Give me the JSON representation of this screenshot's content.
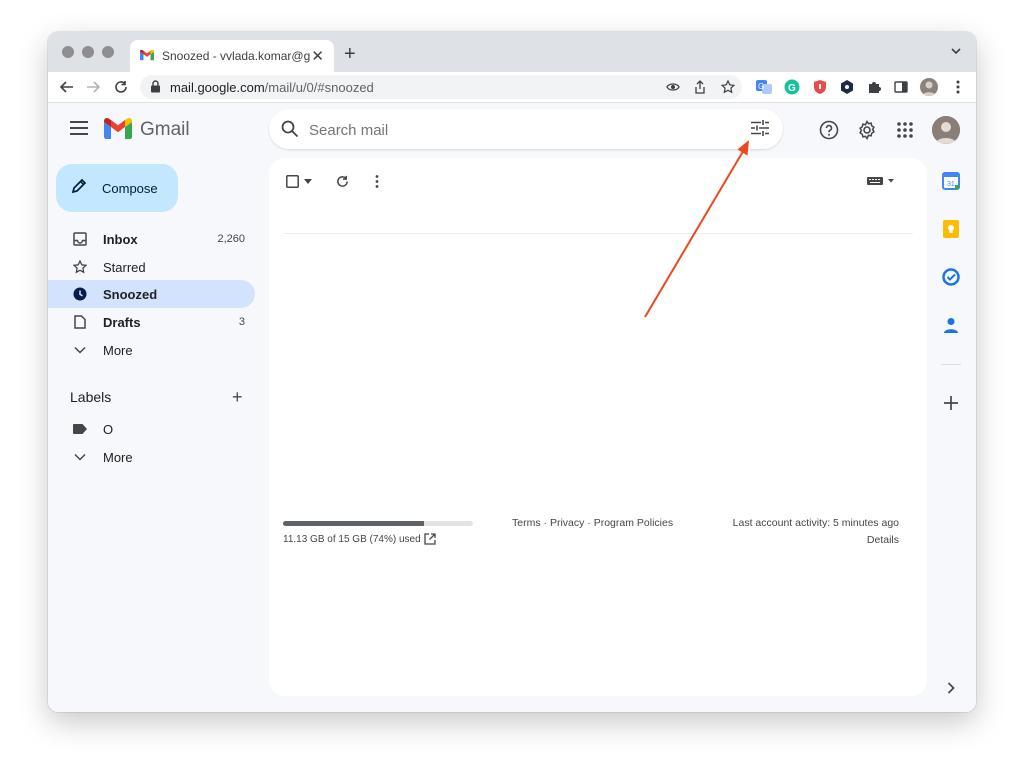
{
  "browser": {
    "tab_title": "Snoozed - vvlada.komar@gma",
    "close_glyph": "✕",
    "newtab_glyph": "+",
    "url_host": "mail.google.com",
    "url_path": "/mail/u/0/#snoozed"
  },
  "gmail": {
    "brand": "Gmail",
    "search_placeholder": "Search mail",
    "compose_label": "Compose",
    "nav": [
      {
        "label": "Inbox",
        "count": "2,260",
        "icon": "inbox-icon"
      },
      {
        "label": "Starred",
        "count": "",
        "icon": "star-icon"
      },
      {
        "label": "Snoozed",
        "count": "",
        "icon": "clock-icon"
      },
      {
        "label": "Drafts",
        "count": "3",
        "icon": "draft-icon"
      },
      {
        "label": "More",
        "count": "",
        "icon": "chevron-down-icon"
      }
    ],
    "labels_title": "Labels",
    "labels_add": "+",
    "labels": [
      {
        "label": "O",
        "icon": "label-icon"
      },
      {
        "label": "More",
        "icon": "chevron-down-icon"
      }
    ],
    "storage": {
      "used_fraction": 0.74,
      "text": "11.13 GB of 15 GB (74%) used"
    },
    "footer": {
      "terms": "Terms",
      "privacy": "Privacy",
      "program_policies": "Program Policies",
      "separator": " · ",
      "last_activity": "Last account activity: 5 minutes ago",
      "details": "Details"
    }
  },
  "colors": {
    "accent_compose": "#c2e7ff",
    "active_nav": "#d3e3fd",
    "annotation_arrow": "#e8491d"
  }
}
